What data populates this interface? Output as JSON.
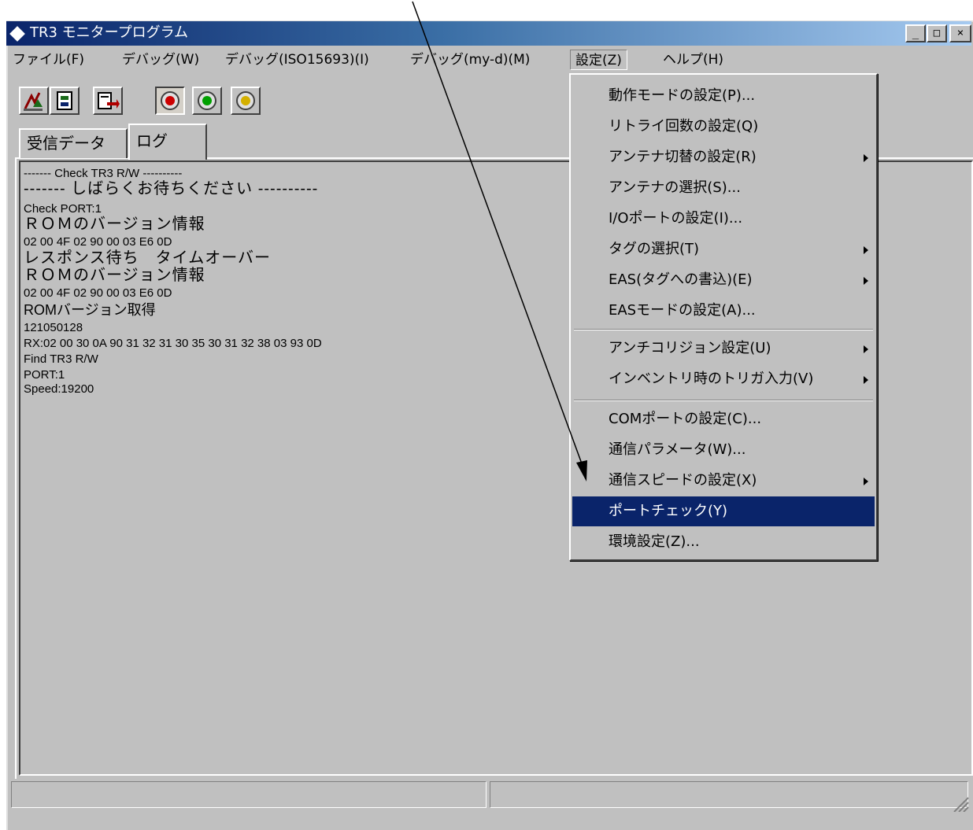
{
  "window": {
    "title": "TR3 モニタープログラム",
    "buttons": {
      "minimize": "_",
      "maximize": "□",
      "close": "×"
    }
  },
  "menubar": {
    "items": [
      "ファイル(F)",
      "デバッグ(W)",
      "デバッグ(ISO15693)(I)",
      "デバッグ(my-d)(M)",
      "設定(Z)",
      "ヘルプ(H)"
    ]
  },
  "toolbar": {
    "icons": [
      "antenna-tool-icon",
      "panel-tool-icon",
      "export-tool-icon",
      "red-lamp-icon",
      "green-lamp-icon",
      "yellow-lamp-icon"
    ]
  },
  "tabs": [
    "受信データ",
    "ログ"
  ],
  "log": {
    "lines": [
      "------- Check TR3 R/W ----------",
      "------- しばらくお待ちください ----------",
      "Check PORT:1",
      "ＲＯＭのバージョン情報",
      "02 00 4F 02 90 00 03 E6 0D",
      "レスポンス待ち　タイムオーバー",
      "ＲＯＭのバージョン情報",
      "02 00 4F 02 90 00 03 E6 0D",
      "ROMバージョン取得",
      "121050128",
      "RX:02 00 30 0A 90 31 32 31 30 35 30 31 32 38 03 93 0D",
      "Find TR3 R/W",
      "PORT:1",
      "Speed:19200"
    ]
  },
  "settings_menu": {
    "items": [
      "動作モードの設定(P)...",
      "リトライ回数の設定(Q)",
      "アンテナ切替の設定(R)",
      "アンテナの選択(S)...",
      "I/Oポートの設定(I)...",
      "タグの選択(T)",
      "EAS(タグへの書込)(E)",
      "EASモードの設定(A)...",
      "アンチコリジョン設定(U)",
      "インベントリ時のトリガ入力(V)",
      "COMポートの設定(C)...",
      "通信パラメータ(W)...",
      "通信スピードの設定(X)",
      "ポートチェック(Y)",
      "環境設定(Z)..."
    ],
    "highlighted": "ポートチェック(Y)"
  }
}
